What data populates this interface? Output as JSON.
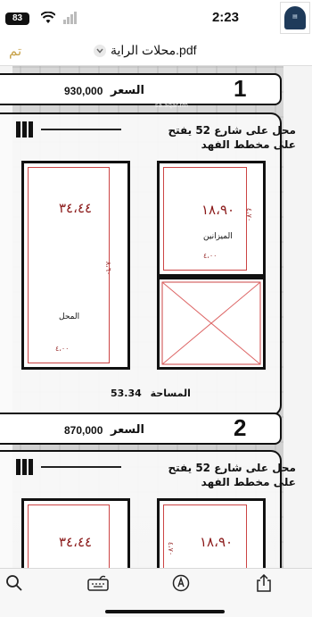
{
  "status": {
    "time": "2:23",
    "battery": "83"
  },
  "nav": {
    "done": "تم",
    "title": "محلات الراية.pdf"
  },
  "units": [
    {
      "number": "1",
      "price_label": "السعر",
      "price": "930,000",
      "title": "محل على شارع 52 يفتح على مخطط الفهد",
      "shop_area": "٣٤،٤٤",
      "shop_label": "المحل",
      "shop_width": "٤،٠٠",
      "shop_depth": "٨،٦٠",
      "mezz_area": "١٨،٩٠",
      "mezz_label": "الميزانين",
      "mezz_width": "٤،٠٠",
      "mezz_depth": "٤،٧٠",
      "area_label": "المساحة",
      "area_value": "53.34"
    },
    {
      "number": "2",
      "price_label": "السعر",
      "price": "870,000",
      "title": "محل على شارع 52 يفتح على مخطط الفهد",
      "shop_area": "٣٤،٤٤",
      "mezz_area": "١٨،٩٠",
      "mezz_depth": "٤،٧٠"
    }
  ],
  "watermark": "عقار",
  "watermark_url": "sa.aqar.fm",
  "toolbar": {
    "icons": [
      "search-icon",
      "markup-icon",
      "highlighter-icon",
      "share-icon"
    ]
  }
}
